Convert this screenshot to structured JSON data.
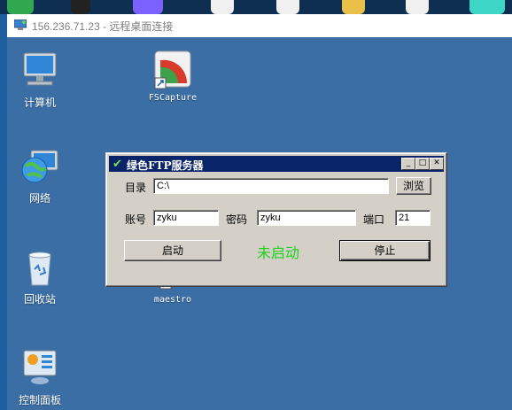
{
  "rdp_window": {
    "title": "156.236.71.23 - 远程桌面连接"
  },
  "desktop": {
    "icons": [
      {
        "label": "计算机",
        "icon": "computer-icon"
      },
      {
        "label": "FSCapture",
        "icon": "fscapture-icon"
      },
      {
        "label": "网络",
        "icon": "network-globe-icon"
      },
      {
        "label": "回收站",
        "icon": "recycle-bin-icon"
      },
      {
        "label": "maestro",
        "icon": "folder-shortcut-icon"
      },
      {
        "label": "控制面板",
        "icon": "control-panel-icon"
      }
    ]
  },
  "ftp_dialog": {
    "title": "绿色FTP服务器",
    "dir_label": "目录",
    "dir_value": "C:\\",
    "browse_label": "浏览",
    "account_label": "账号",
    "account_value": "zyku",
    "password_label": "密码",
    "password_value": "zyku",
    "port_label": "端口",
    "port_value": "21",
    "start_label": "启动",
    "status_text": "未启动",
    "stop_label": "停止",
    "status_color": "#1fd11f",
    "title_bar_color": "#0a246a"
  },
  "colors": {
    "desktop_bg": "#3a6ea5",
    "dialog_bg": "#d4d0c8"
  }
}
